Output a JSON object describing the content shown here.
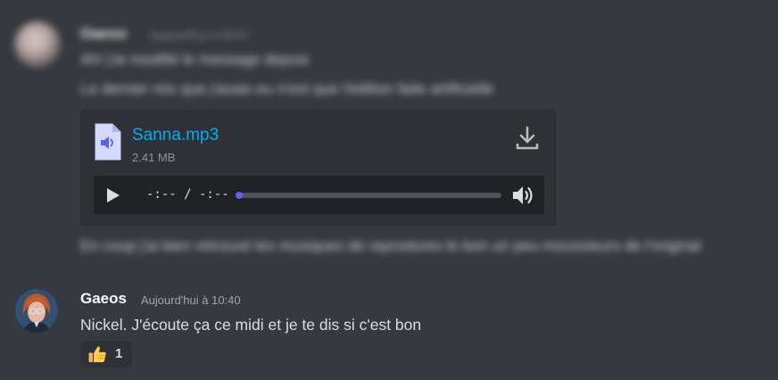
{
  "blurred_message": {
    "author": "Oaeso",
    "time": "Aujourd'hui à 09:57",
    "line1": "Ah! j'ai modifié le message depuis",
    "line2": "Le dernier mix que j'avais eu n'est que l'édition faite artificielle",
    "line3": "En coup j'ai bien retrouvé les musiques de reprodures le bon un peu moussieurs de l'original"
  },
  "attachment": {
    "file_name": "Sanna.mp3",
    "file_size": "2.41 MB",
    "player_time": "-:-- / -:--",
    "progress": 0,
    "icons": {
      "file": "audio-file-icon",
      "download": "download-icon",
      "play": "play-icon",
      "volume": "volume-icon"
    }
  },
  "message": {
    "author": "Gaeos",
    "timestamp": "Aujourd'hui à 10:40",
    "text": "Nickel. J'écoute ça ce midi et je te dis si c'est bon",
    "reaction": {
      "emoji": "thumbs-up-icon",
      "count": "1"
    }
  },
  "colors": {
    "background": "#36393f",
    "attachment_bg": "#2f3136",
    "player_bg": "#202225",
    "link": "#00aff4",
    "accent": "#5865f2"
  }
}
